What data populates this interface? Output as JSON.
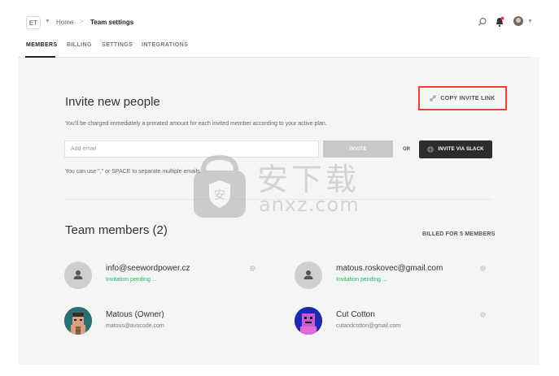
{
  "topbar": {
    "workspace_badge": "ET",
    "breadcrumb": {
      "home": "Home",
      "separator": ">",
      "current": "Team settings"
    },
    "icons": [
      "search-icon",
      "bell-icon",
      "avatar",
      "chevron-down-icon"
    ]
  },
  "tabs": [
    {
      "label": "MEMBERS",
      "active": true
    },
    {
      "label": "BILLING",
      "active": false
    },
    {
      "label": "SETTINGS",
      "active": false
    },
    {
      "label": "INTEGRATIONS",
      "active": false
    }
  ],
  "invite": {
    "title": "Invite new people",
    "description": "You'll be charged immediately a prorated amount for each invited member according to your active plan.",
    "copy_link_label": "COPY INVITE LINK",
    "email_placeholder": "Add email",
    "invite_button": "INVITE",
    "or_label": "OR",
    "slack_button": "INVITE VIA SLACK",
    "hint": "You can use \",\" or SPACE to separate multiple emails."
  },
  "team": {
    "title": "Team members (2)",
    "billed_label": "BILLED FOR 5 MEMBERS",
    "members": [
      {
        "name": "info@seewordpower.cz",
        "subtitle": "Invitation pending ...",
        "status": "pending"
      },
      {
        "name": "matous.roskovec@gmail.com",
        "subtitle": "Invitation pending ...",
        "status": "pending"
      },
      {
        "name": "Matous (Owner)",
        "subtitle": "matous@avocode.com",
        "status": "active"
      },
      {
        "name": "Cut Cotton",
        "subtitle": "cutandcotton@gmail.com",
        "status": "active"
      }
    ]
  },
  "watermark": {
    "cn": "安下载",
    "en": "anxz.com"
  },
  "colors": {
    "accent_border": "#e8432f",
    "pending_green": "#1cb86c",
    "panel_bg": "#f5f5f5",
    "slack_button_bg": "#2c2c2c",
    "invite_button_bg": "#c8c8c8"
  }
}
